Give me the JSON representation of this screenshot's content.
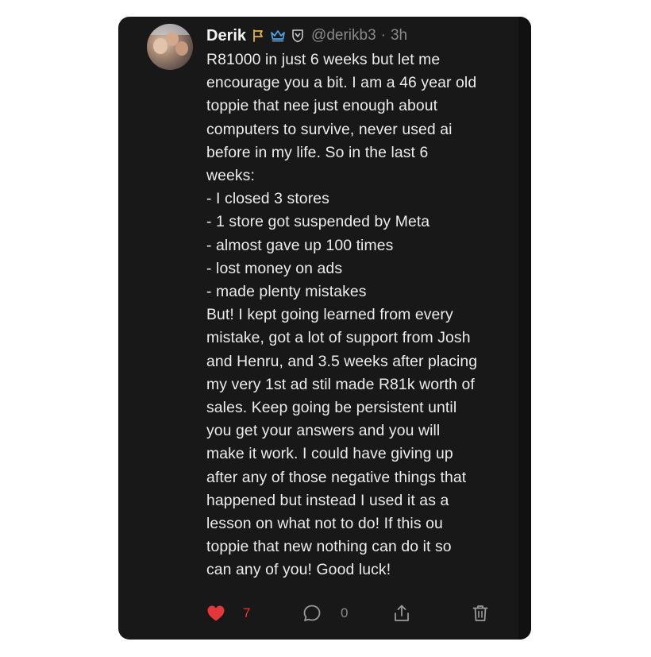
{
  "post": {
    "author": {
      "name": "Derik",
      "handle": "@derikb3",
      "separator": "·",
      "time": "3h",
      "badges": [
        {
          "icon": "flag-icon",
          "color": "#e0b43a"
        },
        {
          "icon": "crown-icon",
          "color": "#4ea3e8"
        },
        {
          "icon": "shield-badge-icon",
          "color": "#c8c8c8"
        }
      ]
    },
    "text": "R81000 in just 6 weeks but let me\nencourage you a bit. I am a 46 year old\ntoppie that nee just enough about\ncomputers to survive, never used ai\nbefore in my life. So in the last 6\nweeks:\n- I closed 3 stores\n- 1 store got suspended by Meta\n- almost gave up 100 times\n- lost money on ads\n- made plenty mistakes\nBut! I kept going learned from every\nmistake, got a lot of support from Josh\nand Henru, and 3.5 weeks after placing\nmy very 1st ad stil made R81k worth of\nsales. Keep going be persistent until\nyou get your answers and you will\nmake it work. I could have giving up\nafter any of those negative things that\nhappened but instead I used it as a\nlesson on what not to do! If this ou\ntoppie that new nothing can do it so\ncan any of you! Good luck!",
    "actions": {
      "like_count": "7",
      "reply_count": "0",
      "like_color": "#e4373a"
    }
  }
}
